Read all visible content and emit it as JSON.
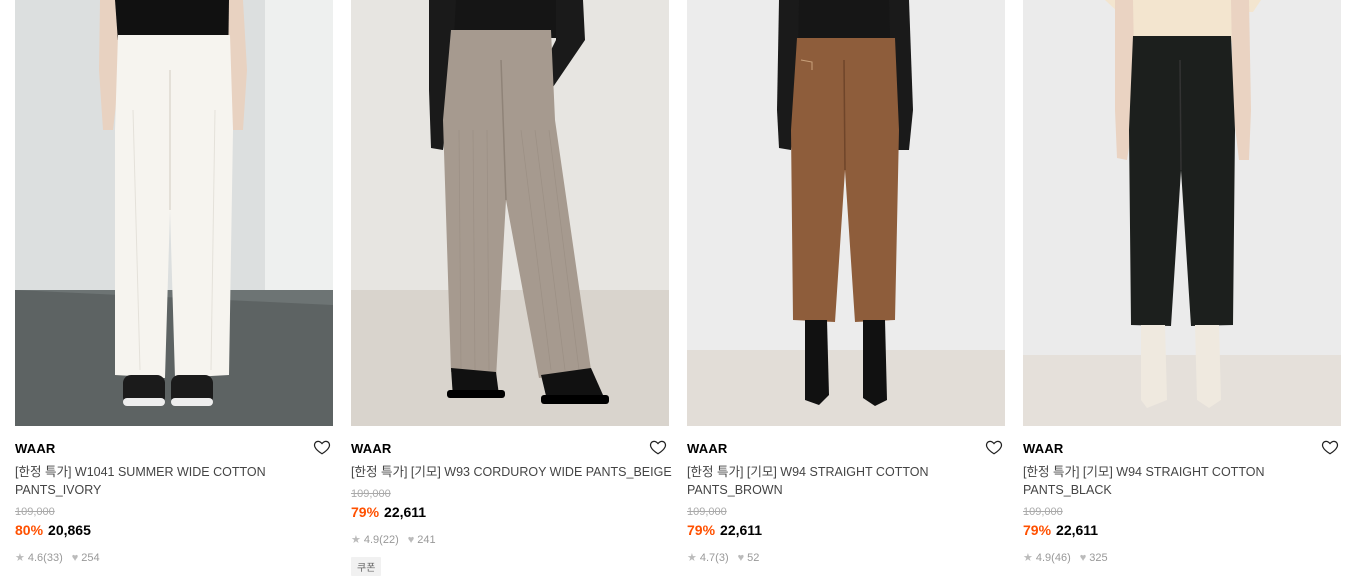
{
  "colors": {
    "discount": "#ff5000",
    "text_muted": "#999999"
  },
  "products": [
    {
      "brand": "WAAR",
      "name": "[한정 특가] W1041 SUMMER WIDE COTTON PANTS_IVORY",
      "original_price": "109,000",
      "discount": "80%",
      "price": "20,865",
      "rating": "4.6",
      "reviews": "(33)",
      "likes": "254",
      "image": "white wide cotton pants on model"
    },
    {
      "brand": "WAAR",
      "name": "[한정 특가] [기모] W93 CORDUROY WIDE PANTS_BEIGE",
      "original_price": "109,000",
      "discount": "79%",
      "price": "22,611",
      "rating": "4.9",
      "reviews": "(22)",
      "likes": "241",
      "badge": "쿠폰",
      "image": "beige corduroy wide pants on model"
    },
    {
      "brand": "WAAR",
      "name": "[한정 특가] [기모] W94 STRAIGHT COTTON PANTS_BROWN",
      "original_price": "109,000",
      "discount": "79%",
      "price": "22,611",
      "rating": "4.7",
      "reviews": "(3)",
      "likes": "52",
      "image": "brown straight cotton pants on model"
    },
    {
      "brand": "WAAR",
      "name": "[한정 특가] [기모] W94 STRAIGHT COTTON PANTS_BLACK",
      "original_price": "109,000",
      "discount": "79%",
      "price": "22,611",
      "rating": "4.9",
      "reviews": "(46)",
      "likes": "325",
      "image": "black straight cotton pants on model"
    }
  ]
}
